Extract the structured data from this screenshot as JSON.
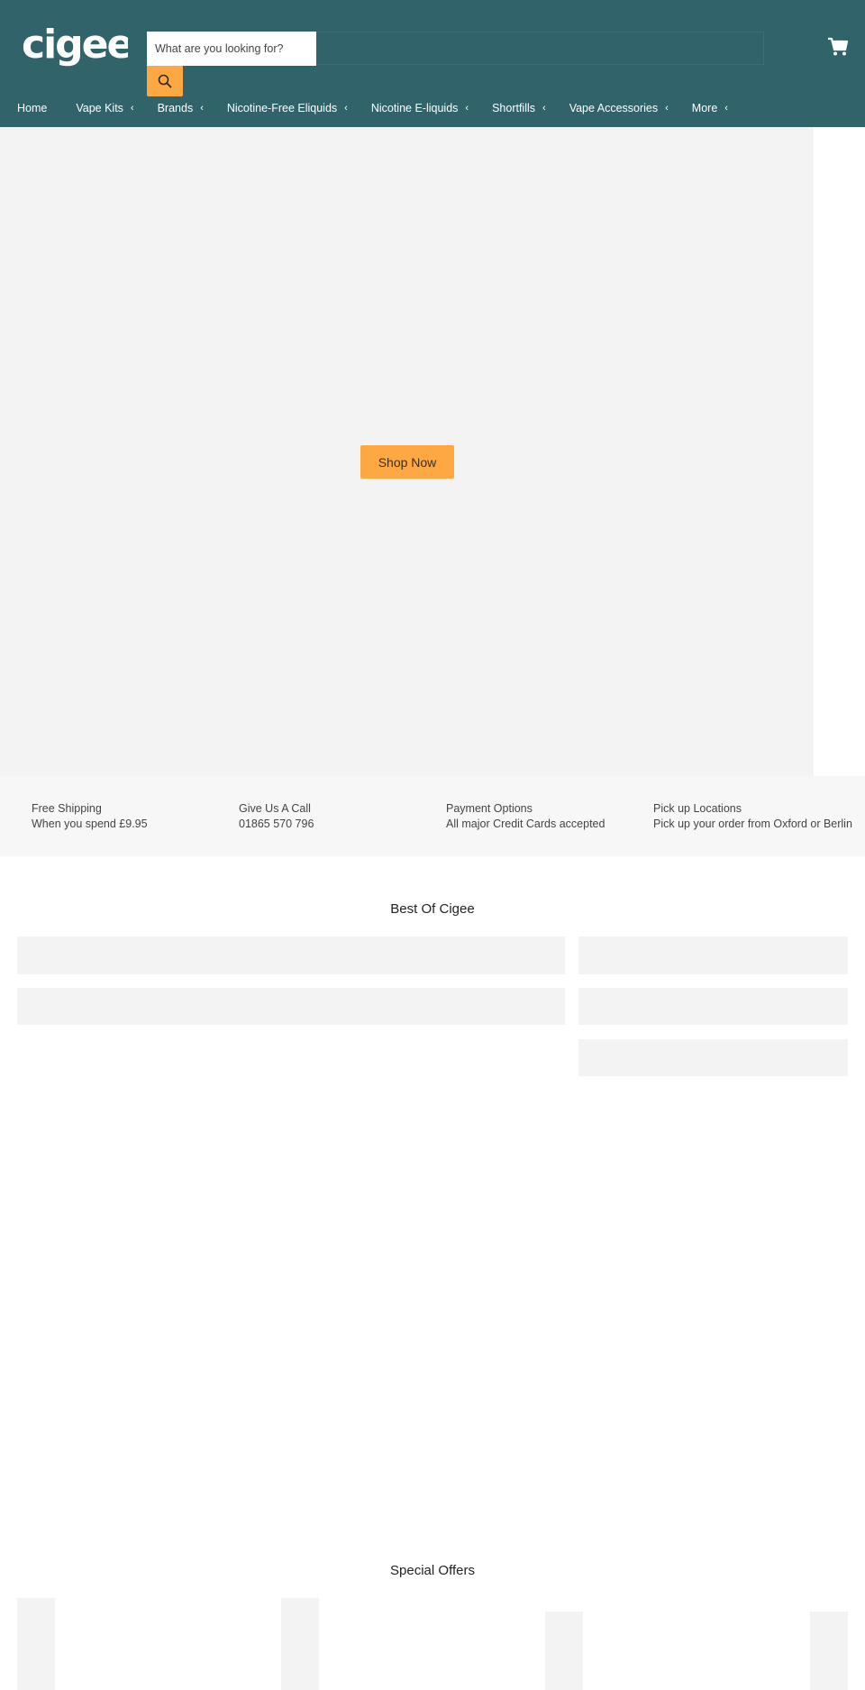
{
  "header": {
    "logo_text": "cigee",
    "search": {
      "placeholder": "What are you looking for?",
      "value": "",
      "button_icon": "search-icon"
    },
    "cart_icon": "cart-icon",
    "colors": {
      "header_bg": "#30646a",
      "accent": "#fda843"
    }
  },
  "nav": {
    "items": [
      {
        "label": "Home",
        "has_dropdown": false
      },
      {
        "label": "Vape Kits",
        "has_dropdown": true
      },
      {
        "label": "Brands",
        "has_dropdown": true
      },
      {
        "label": "Nicotine-Free Eliquids",
        "has_dropdown": true
      },
      {
        "label": "Nicotine E-liquids",
        "has_dropdown": true
      },
      {
        "label": "Shortfills",
        "has_dropdown": true
      },
      {
        "label": "Vape Accessories",
        "has_dropdown": true
      },
      {
        "label": "More",
        "has_dropdown": true
      }
    ],
    "dropdown_glyph": "‹"
  },
  "hero": {
    "button_label": "Shop Now"
  },
  "infobar": {
    "items": [
      {
        "title": "Free Shipping",
        "text": "When you spend £9.95"
      },
      {
        "title": "Give Us A Call",
        "text": "01865 570 796"
      },
      {
        "title": "Payment Options",
        "text": "All major Credit Cards accepted"
      },
      {
        "title": "Pick up Locations",
        "text": "Pick up your order from Oxford or Berlin"
      }
    ]
  },
  "best_of": {
    "title": "Best Of Cigee"
  },
  "special_offers": {
    "title": "Special Offers"
  }
}
